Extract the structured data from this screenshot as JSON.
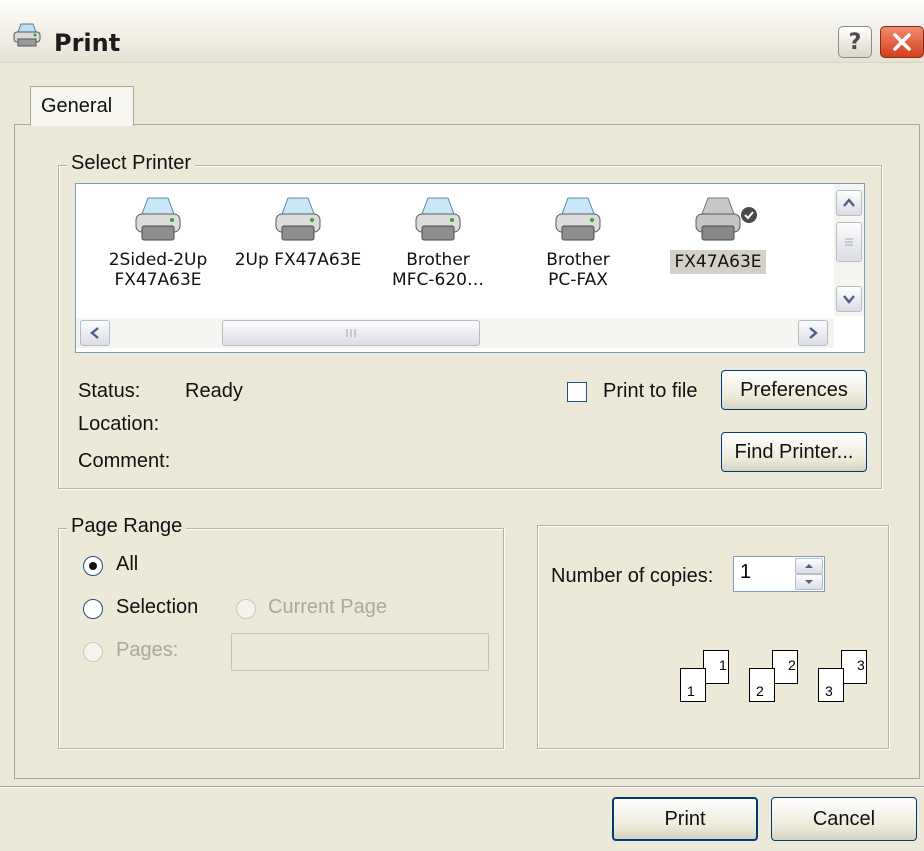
{
  "window": {
    "title": "Print",
    "help_button": "?"
  },
  "tabs": [
    {
      "label": "General"
    }
  ],
  "select_printer": {
    "group_label": "Select Printer",
    "printers": [
      {
        "name_line1": "2Sided-2Up",
        "name_line2": "FX47A63E",
        "selected": false,
        "default": false
      },
      {
        "name_line1": "2Up FX47A63E",
        "name_line2": "",
        "selected": false,
        "default": false
      },
      {
        "name_line1": "Brother",
        "name_line2": "MFC-620…",
        "selected": false,
        "default": false
      },
      {
        "name_line1": "Brother",
        "name_line2": "PC-FAX",
        "selected": false,
        "default": false
      },
      {
        "name_line1": "FX47A63E",
        "name_line2": "",
        "selected": true,
        "default": true
      }
    ],
    "status_label": "Status:",
    "status_value": "Ready",
    "location_label": "Location:",
    "location_value": "",
    "comment_label": "Comment:",
    "comment_value": "",
    "print_to_file_label": "Print to file",
    "print_to_file_checked": false,
    "preferences_label": "Preferences",
    "find_printer_label": "Find Printer..."
  },
  "page_range": {
    "group_label": "Page Range",
    "options": [
      {
        "label": "All",
        "selected": true,
        "enabled": true
      },
      {
        "label": "Selection",
        "selected": false,
        "enabled": true
      },
      {
        "label": "Current Page",
        "selected": false,
        "enabled": false
      },
      {
        "label": "Pages:",
        "selected": false,
        "enabled": false
      }
    ],
    "pages_value": ""
  },
  "copies": {
    "label": "Number of copies:",
    "value": "1",
    "collate_pages": [
      {
        "front": "1",
        "back": "1"
      },
      {
        "front": "2",
        "back": "2"
      },
      {
        "front": "3",
        "back": "3"
      }
    ]
  },
  "footer": {
    "print_label": "Print",
    "cancel_label": "Cancel"
  },
  "colors": {
    "dialog_bg": "#ece9d8",
    "list_border": "#7f9db9",
    "close_button": "#d3401f"
  }
}
